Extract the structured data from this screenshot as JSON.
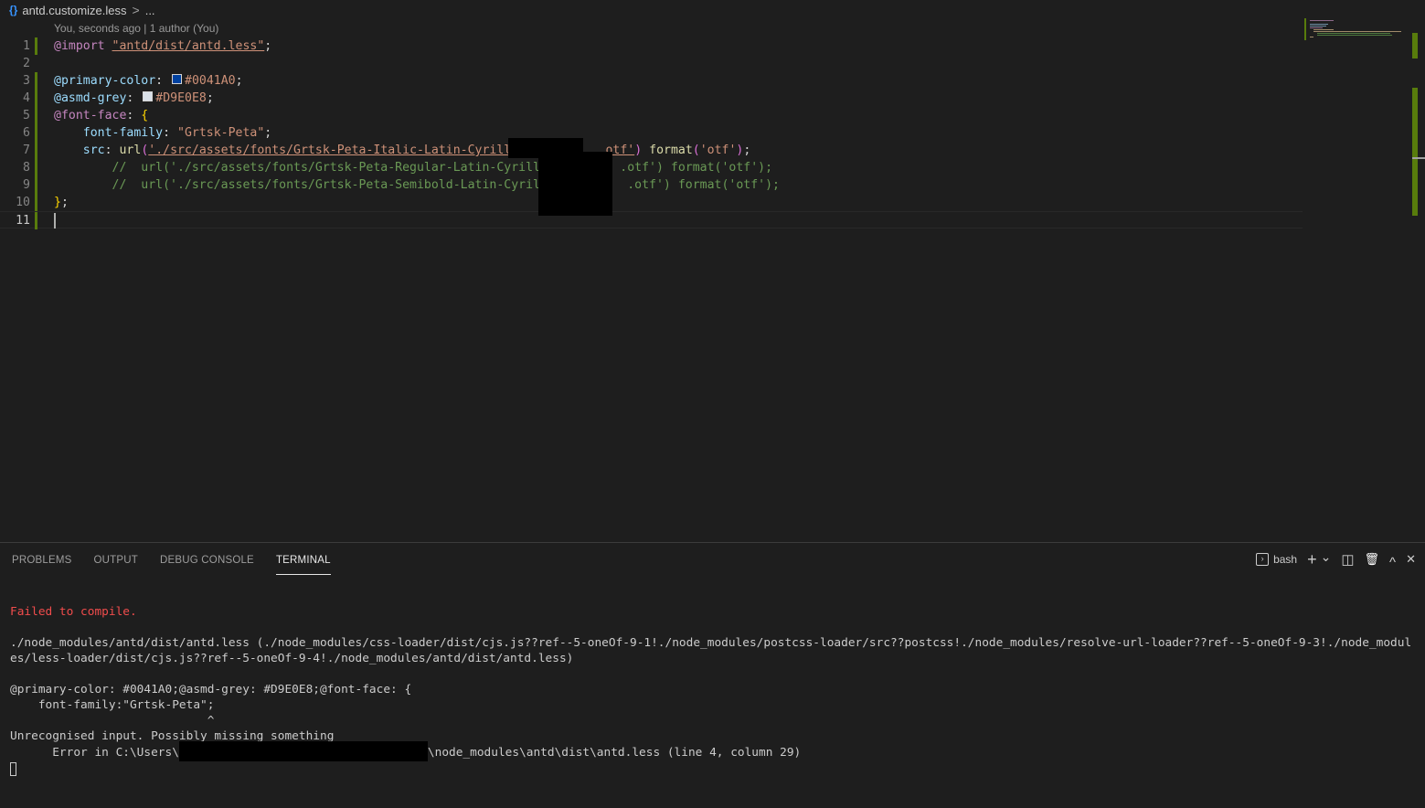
{
  "breadcrumb": {
    "icon": "{}",
    "file": "antd.customize.less",
    "separator": ">",
    "more": "..."
  },
  "codelens": "You, seconds ago | 1 author (You)",
  "editor": {
    "lines": [
      {
        "n": "1",
        "tokens": [
          [
            "t-at",
            "@import"
          ],
          [
            "t-plain",
            " "
          ],
          [
            "t-link",
            "\"antd/dist/antd.less\""
          ],
          [
            "t-plain",
            ";"
          ]
        ]
      },
      {
        "n": "2",
        "tokens": []
      },
      {
        "n": "3",
        "tokens": [
          [
            "t-var",
            "@primary-color"
          ],
          [
            "t-plain",
            ": "
          ],
          [
            "swatch",
            "#0041A0"
          ],
          [
            "t-str",
            "#0041A0"
          ],
          [
            "t-plain",
            ";"
          ]
        ]
      },
      {
        "n": "4",
        "tokens": [
          [
            "t-var",
            "@asmd-grey"
          ],
          [
            "t-plain",
            ": "
          ],
          [
            "swatch",
            "#D9E0E8"
          ],
          [
            "t-str",
            "#D9E0E8"
          ],
          [
            "t-plain",
            ";"
          ]
        ]
      },
      {
        "n": "5",
        "tokens": [
          [
            "t-at",
            "@font-face"
          ],
          [
            "t-plain",
            ": "
          ],
          [
            "t-brace",
            "{"
          ]
        ]
      },
      {
        "n": "6",
        "tokens": [
          [
            "t-plain",
            "    "
          ],
          [
            "t-var",
            "font-family"
          ],
          [
            "t-plain",
            ": "
          ],
          [
            "t-str",
            "\"Grtsk-Peta\""
          ],
          [
            "t-plain",
            ";"
          ]
        ]
      },
      {
        "n": "7",
        "tokens": [
          [
            "t-plain",
            "    "
          ],
          [
            "t-var",
            "src"
          ],
          [
            "t-plain",
            ": "
          ],
          [
            "t-fn",
            "url"
          ],
          [
            "t-paren",
            "("
          ],
          [
            "t-link",
            "'./src/assets/fonts/Grtsk-Peta-Italic-Latin-Cyrillic          .otf'"
          ],
          [
            "t-paren",
            ")"
          ],
          [
            "t-plain",
            " "
          ],
          [
            "t-fn",
            "format"
          ],
          [
            "t-paren",
            "("
          ],
          [
            "t-str",
            "'otf'"
          ],
          [
            "t-paren",
            ")"
          ],
          [
            "t-plain",
            ";"
          ]
        ]
      },
      {
        "n": "8",
        "tokens": [
          [
            "t-plain",
            "        "
          ],
          [
            "t-cmt",
            "//  url('./src/assets/fonts/Grtsk-Peta-Regular-Latin-Cyrillic         .otf') format('otf');"
          ]
        ]
      },
      {
        "n": "9",
        "tokens": [
          [
            "t-plain",
            "        "
          ],
          [
            "t-cmt",
            "//  url('./src/assets/fonts/Grtsk-Peta-Semibold-Latin-Cyrilli          .otf') format('otf');"
          ]
        ]
      },
      {
        "n": "10",
        "tokens": [
          [
            "t-brace",
            "}"
          ],
          [
            "t-plain",
            ";"
          ]
        ]
      },
      {
        "n": "11",
        "tokens": []
      }
    ]
  },
  "panel": {
    "tabs": [
      "PROBLEMS",
      "OUTPUT",
      "DEBUG CONSOLE",
      "TERMINAL"
    ],
    "active_tab": "TERMINAL",
    "shell": "bash",
    "actions": {
      "new_terminal": "+",
      "dropdown": "⌄",
      "split": "◫",
      "kill": "🗑",
      "maximize": "^",
      "close": "✕"
    }
  },
  "terminal": {
    "error_title": "Failed to compile.",
    "path_line": "./node_modules/antd/dist/antd.less (./node_modules/css-loader/dist/cjs.js??ref--5-oneOf-9-1!./node_modules/postcss-loader/src??postcss!./node_modules/resolve-url-loader??ref--5-oneOf-9-3!./node_modules/less-loader/dist/cjs.js??ref--5-oneOf-9-4!./node_modules/antd/dist/antd.less)",
    "src_line1": "@primary-color: #0041A0;@asmd-grey: #D9E0E8;@font-face: {",
    "src_line2": "    font-family:\"Grtsk-Peta\";",
    "caret_line": "                            ^",
    "message": "Unrecognised input. Possibly missing something",
    "error_prefix": "      Error in C:\\Users\\",
    "error_suffix": "\\node_modules\\antd\\dist\\antd.less (line 4, column 29)"
  },
  "colors": {
    "primary": "#0041A0",
    "grey": "#D9E0E8",
    "modified_gutter": "#587c0c",
    "error_text": "#f14c4c"
  }
}
